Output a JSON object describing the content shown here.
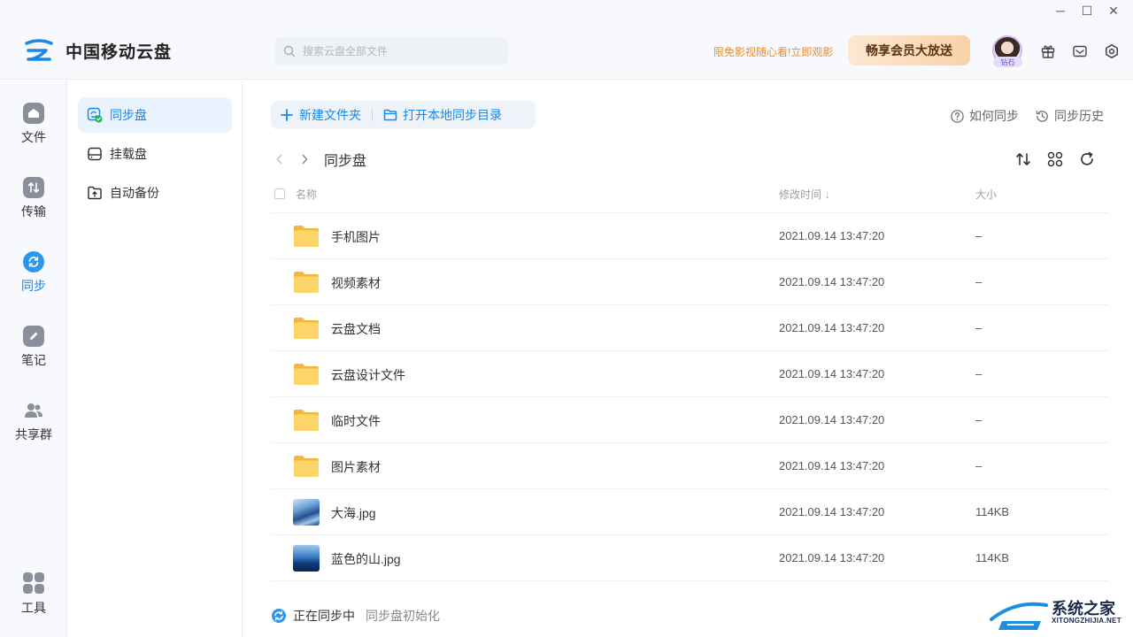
{
  "window": {
    "minimize_glyph": "─",
    "maximize_glyph": "☐",
    "close_glyph": "✕"
  },
  "header": {
    "app_title": "中国移动云盘",
    "search_placeholder": "搜索云盘全部文件",
    "promo_text": "限免影视随心看!立即观影",
    "vip_button": "畅享会员大放送",
    "avatar_badge": "钻石",
    "icons": [
      "gift-icon",
      "mail-icon",
      "settings-icon"
    ]
  },
  "rail": {
    "items": [
      {
        "label": "文件",
        "icon": "cloud-icon"
      },
      {
        "label": "传输",
        "icon": "transfer-icon"
      },
      {
        "label": "同步",
        "icon": "sync-icon",
        "active": true
      },
      {
        "label": "笔记",
        "icon": "pen-icon"
      },
      {
        "label": "共享群",
        "icon": "group-icon"
      },
      {
        "label": "工具",
        "icon": "apps-icon"
      }
    ]
  },
  "subnav": {
    "items": [
      {
        "label": "同步盘",
        "icon": "sync-disk-icon",
        "active": true
      },
      {
        "label": "挂载盘",
        "icon": "mount-disk-icon"
      },
      {
        "label": "自动备份",
        "icon": "auto-backup-icon"
      }
    ]
  },
  "toolbar": {
    "new_folder": "新建文件夹",
    "open_local": "打开本地同步目录",
    "how_to_sync": "如何同步",
    "sync_history": "同步历史"
  },
  "breadcrumb": {
    "title": "同步盘"
  },
  "table": {
    "columns": {
      "name": "名称",
      "modified": "修改时间",
      "modified_arrow": "↓",
      "size": "大小"
    },
    "rows": [
      {
        "name": "手机图片",
        "modified": "2021.09.14 13:47:20",
        "size": "–",
        "type": "folder"
      },
      {
        "name": "视频素材",
        "modified": "2021.09.14 13:47:20",
        "size": "–",
        "type": "folder"
      },
      {
        "name": "云盘文档",
        "modified": "2021.09.14 13:47:20",
        "size": "–",
        "type": "folder"
      },
      {
        "name": "云盘设计文件",
        "modified": "2021.09.14 13:47:20",
        "size": "–",
        "type": "folder"
      },
      {
        "name": "临时文件",
        "modified": "2021.09.14 13:47:20",
        "size": "–",
        "type": "folder"
      },
      {
        "name": "图片素材",
        "modified": "2021.09.14 13:47:20",
        "size": "–",
        "type": "folder"
      },
      {
        "name": "大海.jpg",
        "modified": "2021.09.14 13:47:20",
        "size": "114KB",
        "type": "image-sea"
      },
      {
        "name": "蓝色的山.jpg",
        "modified": "2021.09.14 13:47:20",
        "size": "114KB",
        "type": "image-mountain"
      }
    ]
  },
  "status": {
    "main": "正在同步中",
    "sub": "同步盘初始化"
  },
  "watermark": {
    "title": "系统之家",
    "subtitle": "XITONGZHIJIA.NET"
  },
  "colors": {
    "accent": "#1b87e6",
    "promo": "#f08c1e",
    "folder": "#fbc94d"
  }
}
